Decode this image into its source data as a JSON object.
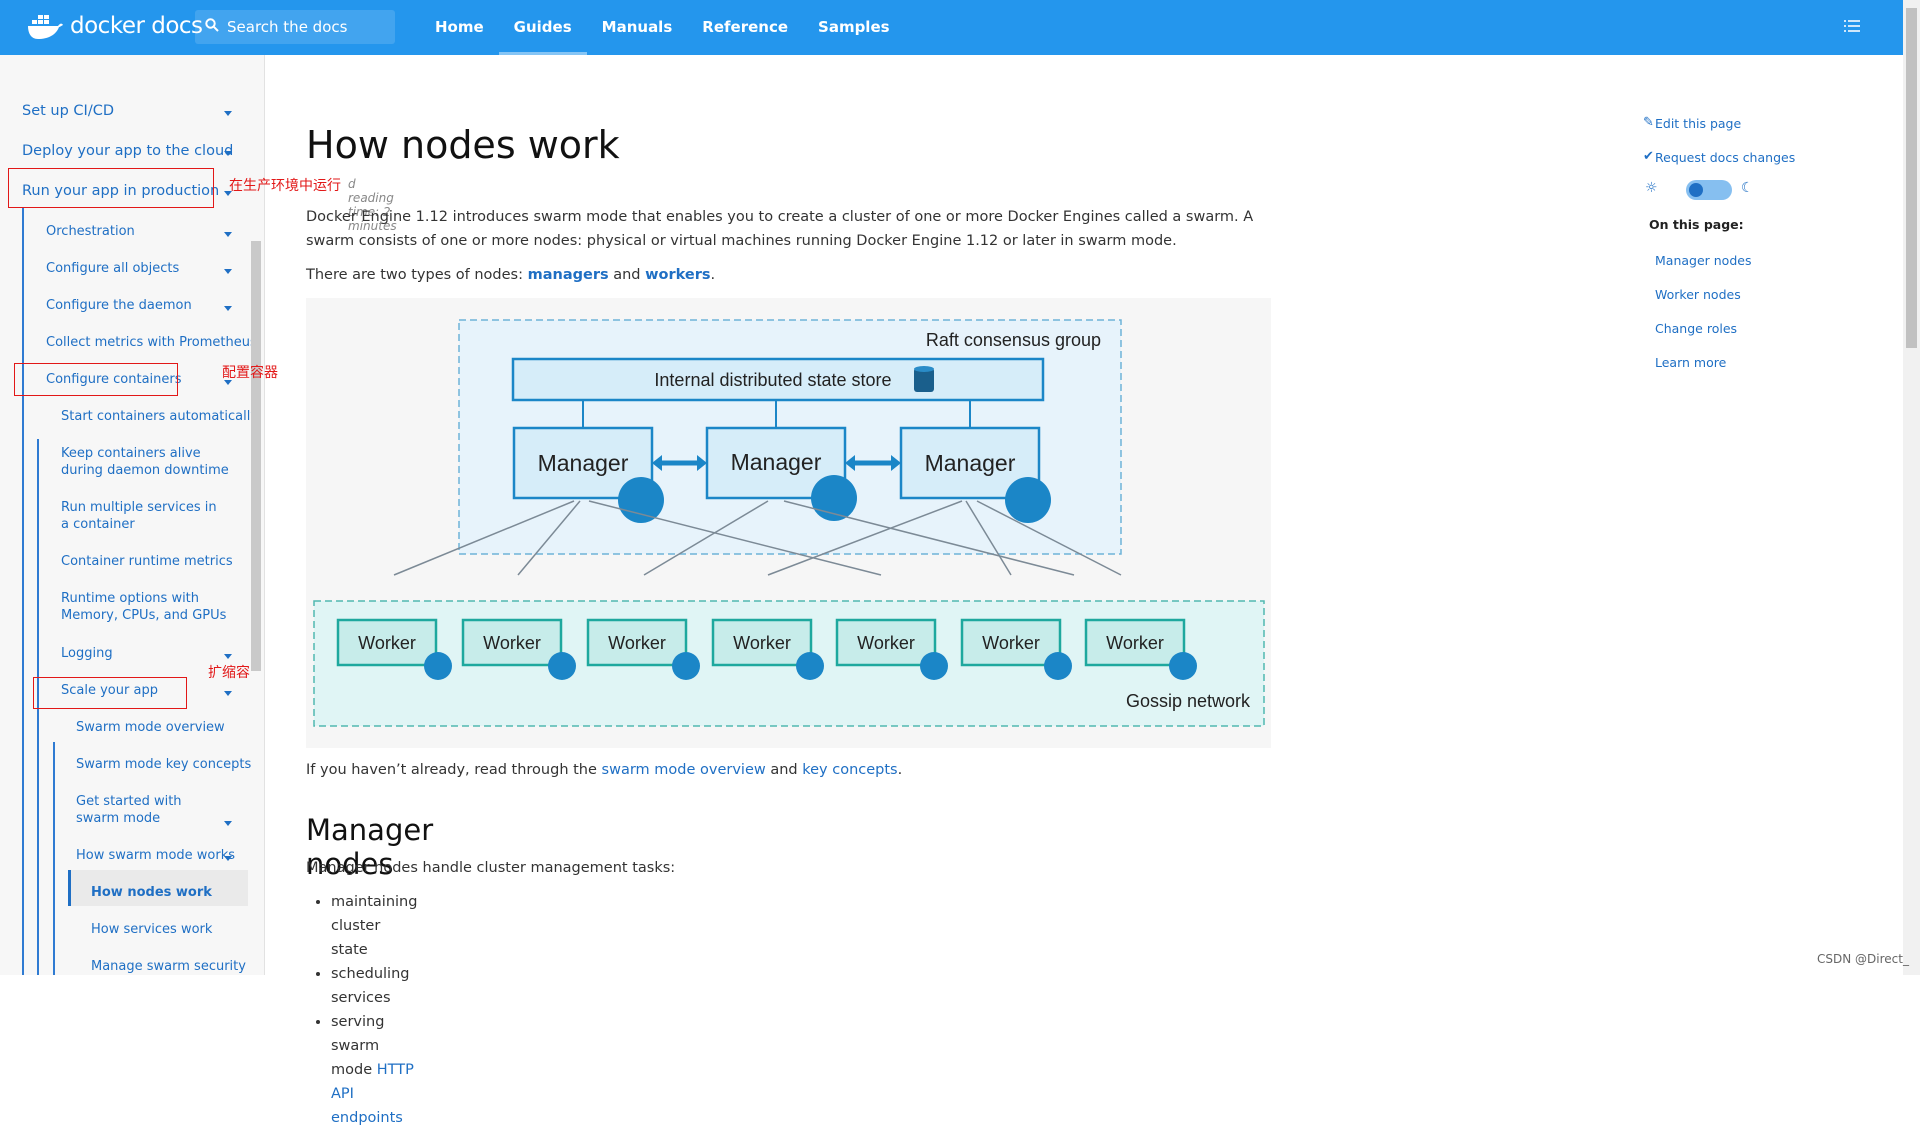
{
  "brand": {
    "logo_text": "docker docs"
  },
  "search": {
    "placeholder": "Search the docs"
  },
  "nav": {
    "items": [
      "Home",
      "Guides",
      "Manuals",
      "Reference",
      "Samples"
    ],
    "active": "Guides"
  },
  "sidebar": {
    "items": [
      {
        "label": "Set up CI/CD"
      },
      {
        "label": "Deploy your app to the cloud"
      },
      {
        "label": "Run your app in production"
      },
      {
        "label": "Orchestration"
      },
      {
        "label": "Configure all objects"
      },
      {
        "label": "Configure the daemon"
      },
      {
        "label": "Collect metrics with Prometheus"
      },
      {
        "label": "Configure containers"
      },
      {
        "label": "Start containers automatically"
      },
      {
        "label": "Keep containers alive during daemon downtime"
      },
      {
        "label": "Run multiple services in a container"
      },
      {
        "label": "Container runtime metrics"
      },
      {
        "label": "Runtime options with Memory, CPUs, and GPUs"
      },
      {
        "label": "Logging"
      },
      {
        "label": "Scale your app"
      },
      {
        "label": "Swarm mode overview"
      },
      {
        "label": "Swarm mode key concepts"
      },
      {
        "label": "Get started with swarm mode"
      },
      {
        "label": "How swarm mode works"
      },
      {
        "label": "How nodes work"
      },
      {
        "label": "How services work"
      },
      {
        "label": "Manage swarm security"
      }
    ],
    "annotations": [
      "在生产环境中运行",
      "配置容器",
      "扩缩容"
    ]
  },
  "article": {
    "title": "How nodes work",
    "reading_time": "d reading time: 2 minutes",
    "intro": "Docker Engine 1.12 introduces swarm mode that enables you to create a cluster of one or more Docker Engines called a swarm. A swarm consists of one or more nodes: physical or virtual machines running Docker Engine 1.12 or later in swarm mode.",
    "types_prefix": "There are two types of nodes: ",
    "types_link1": "managers",
    "types_and": " and ",
    "types_link2": "workers",
    "types_suffix": ".",
    "read_prefix": "If you haven’t already, read through the ",
    "read_link1": "swarm mode overview",
    "read_and": " and ",
    "read_link2": "key concepts",
    "read_suffix": ".",
    "h2_manager": "Manager nodes",
    "manager_intro": "Manager nodes handle cluster management tasks:",
    "manager_tasks": [
      "maintaining cluster state",
      "scheduling services",
      "serving swarm mode "
    ],
    "manager_task_link": "HTTP API endpoints"
  },
  "diagram": {
    "raft_label": "Raft consensus group",
    "store_label": "Internal distributed state store",
    "managers": [
      "Manager",
      "Manager",
      "Manager"
    ],
    "workers": [
      "Worker",
      "Worker",
      "Worker",
      "Worker",
      "Worker",
      "Worker",
      "Worker"
    ],
    "gossip_label": "Gossip network"
  },
  "right": {
    "edit": "Edit this page",
    "request": "Request docs changes",
    "on_this_page": "On this page:",
    "toc": [
      "Manager nodes",
      "Worker nodes",
      "Change roles",
      "Learn more"
    ]
  },
  "watermark": "CSDN @Direct_"
}
